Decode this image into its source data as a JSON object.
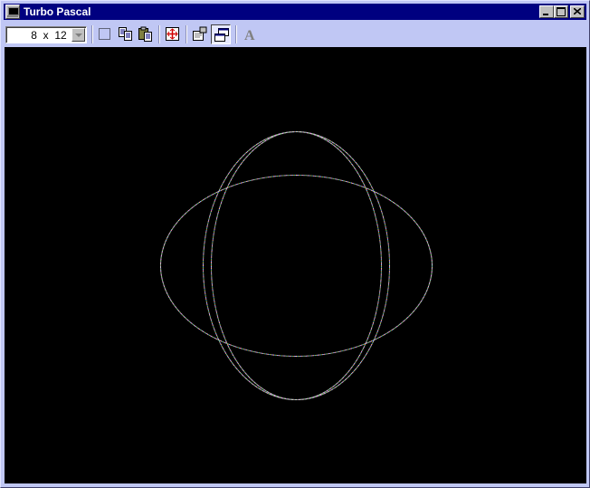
{
  "window": {
    "title": "Turbo Pascal",
    "accent_color": "#000080",
    "frame_color": "#c0c7f4"
  },
  "titlebar_buttons": [
    {
      "name": "minimize-button",
      "icon": "minimize-icon"
    },
    {
      "name": "maximize-button",
      "icon": "maximize-icon"
    },
    {
      "name": "close-button",
      "icon": "close-icon"
    }
  ],
  "toolbar": {
    "font_size_value": " 8  x  12 ",
    "buttons": [
      {
        "name": "mark-button",
        "icon": "dotted-rectangle-icon"
      },
      {
        "name": "copy-button",
        "icon": "copy-icon"
      },
      {
        "name": "paste-button",
        "icon": "paste-icon"
      },
      {
        "name": "full-screen-button",
        "icon": "full-screen-icon"
      },
      {
        "name": "properties-button",
        "icon": "properties-icon"
      },
      {
        "name": "background-button",
        "icon": "background-icon",
        "pressed": true
      },
      {
        "name": "font-button",
        "icon": "font-a-icon"
      }
    ]
  },
  "canvas": {
    "background": "#000000",
    "curve_colors": [
      "#ff6060",
      "#60ff60",
      "#6060ff",
      "#ffff60",
      "#ff60ff",
      "#60ffff"
    ]
  }
}
